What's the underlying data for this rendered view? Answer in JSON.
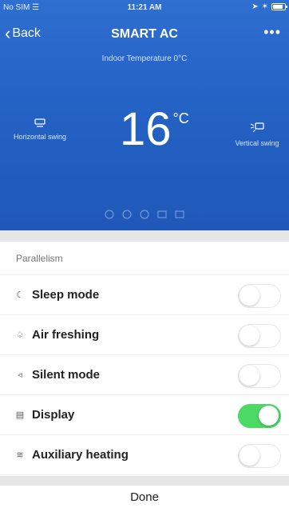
{
  "status_bar": {
    "carrier": "No SIM",
    "time": "11:21 AM"
  },
  "nav": {
    "back_label": "Back",
    "title": "SMART AC",
    "more_label": "•••"
  },
  "climate": {
    "indoor_temperature": "Indoor Temperature 0°C",
    "set_temperature": "16",
    "unit": "°C",
    "horizontal_swing": "Horizontal swing",
    "vertical_swing": "Vertical swing"
  },
  "list": {
    "section": "Parallelism",
    "items": [
      {
        "label": "Sleep mode",
        "icon": "moon-icon",
        "glyph": "☾",
        "enabled": false
      },
      {
        "label": "Air freshing",
        "icon": "leaf-icon",
        "glyph": "♤",
        "enabled": false
      },
      {
        "label": "Silent mode",
        "icon": "speaker-icon",
        "glyph": "◃",
        "enabled": false
      },
      {
        "label": "Display",
        "icon": "display-icon",
        "glyph": "▤",
        "enabled": true
      },
      {
        "label": "Auxiliary heating",
        "icon": "heat-icon",
        "glyph": "≋",
        "enabled": false
      }
    ]
  },
  "done_label": "Done",
  "colors": {
    "header_blue": "#2563c6",
    "toggle_on": "#4cd964"
  }
}
